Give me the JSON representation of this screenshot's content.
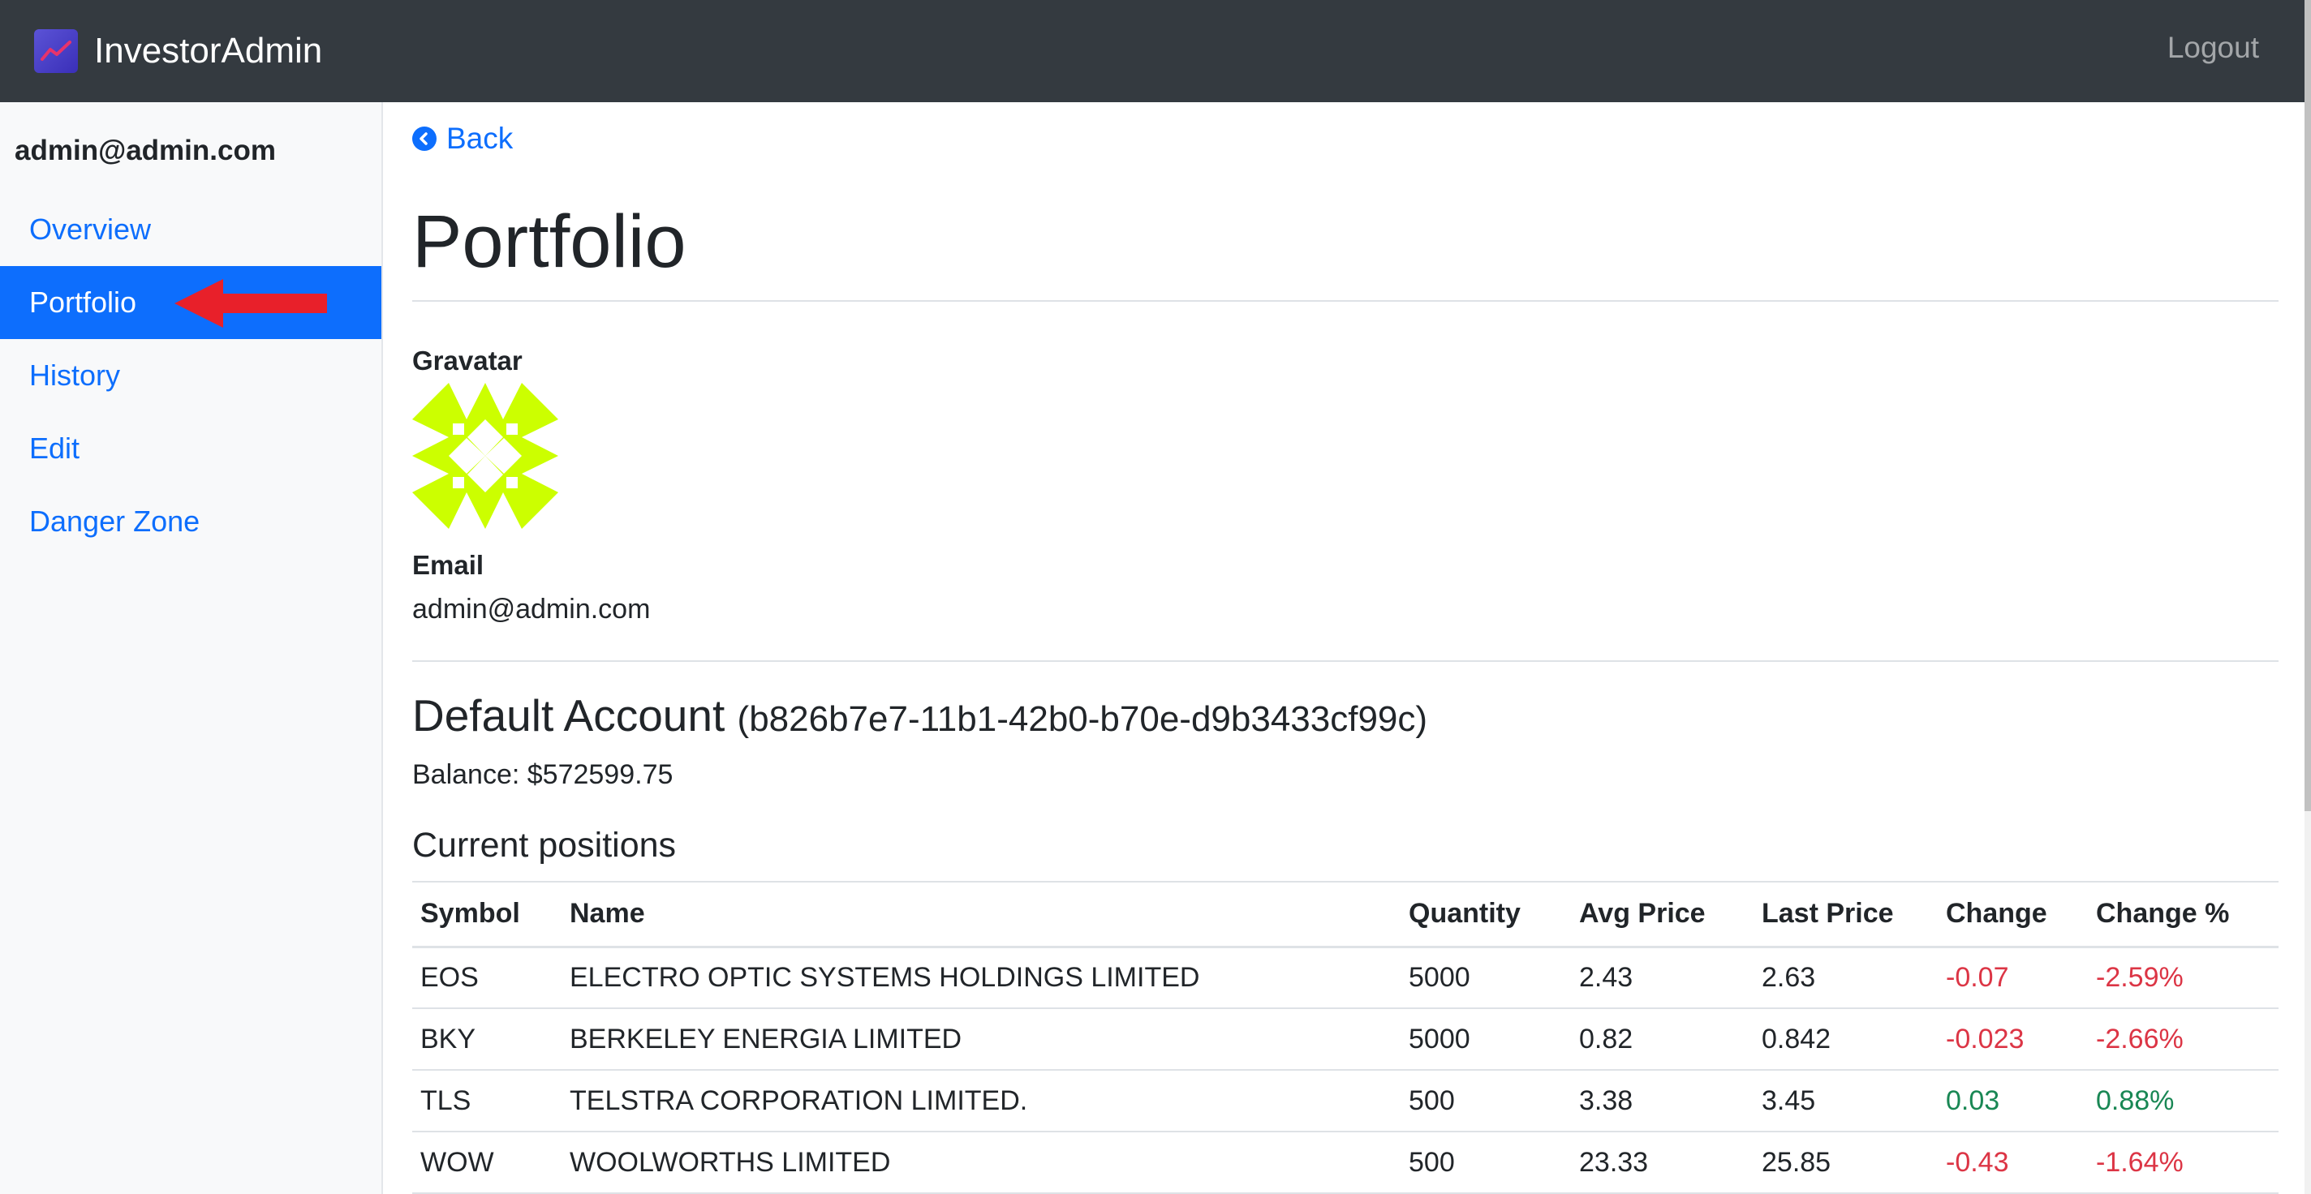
{
  "header": {
    "brand": "InvestorAdmin",
    "brand_icon": "chart-trend-icon",
    "logout_label": "Logout"
  },
  "sidebar": {
    "user_email": "admin@admin.com",
    "items": [
      {
        "label": "Overview",
        "active": false
      },
      {
        "label": "Portfolio",
        "active": true
      },
      {
        "label": "History",
        "active": false
      },
      {
        "label": "Edit",
        "active": false
      },
      {
        "label": "Danger Zone",
        "active": false
      }
    ]
  },
  "main": {
    "back_label": "Back",
    "page_title": "Portfolio",
    "gravatar_label": "Gravatar",
    "email_label": "Email",
    "email_value": "admin@admin.com",
    "account_name": "Default Account",
    "account_id": "b826b7e7-11b1-42b0-b70e-d9b3433cf99c",
    "balance_text": "Balance: $572599.75",
    "positions_heading": "Current positions",
    "table": {
      "columns": [
        "Symbol",
        "Name",
        "Quantity",
        "Avg Price",
        "Last Price",
        "Change",
        "Change %"
      ],
      "rows": [
        [
          "EOS",
          "ELECTRO OPTIC SYSTEMS HOLDINGS LIMITED",
          "5000",
          "2.43",
          "2.63",
          "-0.07",
          "-2.59%"
        ],
        [
          "BKY",
          "BERKELEY ENERGIA LIMITED",
          "5000",
          "0.82",
          "0.842",
          "-0.023",
          "-2.66%"
        ],
        [
          "TLS",
          "TELSTRA CORPORATION LIMITED.",
          "500",
          "3.38",
          "3.45",
          "0.03",
          "0.88%"
        ],
        [
          "WOW",
          "WOOLWORTHS LIMITED",
          "500",
          "23.33",
          "25.85",
          "-0.43",
          "-1.64%"
        ]
      ]
    }
  },
  "colors": {
    "topbar": "#343a40",
    "accent": "#0d6efd",
    "negative": "#dc3545",
    "positive": "#198754",
    "annotation_arrow": "#e8202a",
    "gravatar": "#ccff00"
  }
}
